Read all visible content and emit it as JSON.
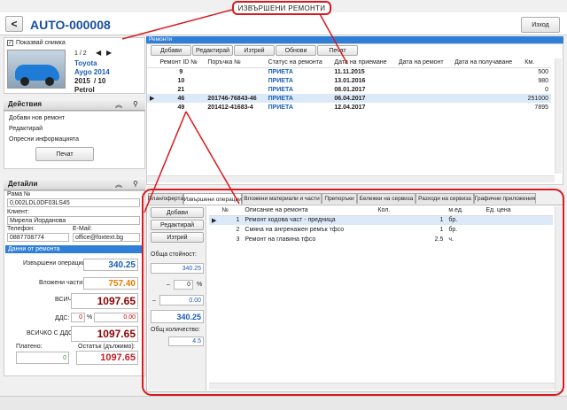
{
  "annotation": {
    "title": "ИЗВЪРШЕНИ РЕМОНТИ"
  },
  "header": {
    "back": "<",
    "title": "AUTO-000008",
    "exit": "Изход"
  },
  "vehicle": {
    "show_image": "Показвай снимка",
    "pager": "1 / 2",
    "make": "Toyota",
    "model": "Aygo 2014",
    "year": "2015",
    "month": "/ 10",
    "fuel": "Petrol"
  },
  "actions": {
    "title": "Действия",
    "items": [
      "Добави нов ремонт",
      "Редактирай",
      "Опресни информацията"
    ],
    "print": "Печат"
  },
  "details": {
    "title": "Детайли",
    "vin_label": "Рама №",
    "vin": "0,002LDL0DF03LS45",
    "client_label": "Клиент:",
    "client": "Мирела Йорданова",
    "phone_label": "Телефон:",
    "phone": "0887708774",
    "email_label": "E-Mail:",
    "email": "office@foxtext.bg",
    "repair_data": "Данни от ремонта",
    "ops_label": "Извършени операции:",
    "ops": "340.25",
    "parts_label": "Вложени части:",
    "parts": "757.40",
    "total_label": "ВСИЧКО:",
    "total": "1097.65",
    "vat_label": "ДДС:",
    "vat_pct": "0",
    "vat_sign": "%",
    "vat_val": "0.00",
    "total_vat_label": "ВСИЧКО С ДДС:",
    "total_vat": "1097.65",
    "paid_label": "Платено:",
    "paid": "0",
    "remaining_label": "Остатък (дължимо):",
    "remaining": "1097.65"
  },
  "repairs": {
    "tab": "Ремонти",
    "toolbar": [
      "Добави",
      "Редактирай",
      "Изтрий",
      "Обнови",
      "Печат"
    ],
    "columns": [
      "Ремонт ID №",
      "Поръчка №",
      "Статус на ремонта",
      "Дата на приемане",
      "Дата на ремонт",
      "Дата на получаване",
      "Км."
    ],
    "rows": [
      {
        "id": "9",
        "order": "",
        "status": "ПРИЕТА",
        "received": "11.11.2015",
        "repaired": "",
        "delivered": "",
        "km": "500",
        "selected": false
      },
      {
        "id": "10",
        "order": "",
        "status": "ПРИЕТА",
        "received": "13.01.2016",
        "repaired": "",
        "delivered": "",
        "km": "980",
        "selected": false
      },
      {
        "id": "21",
        "order": "",
        "status": "ПРИЕТА",
        "received": "08.01.2017",
        "repaired": "",
        "delivered": "",
        "km": "0",
        "selected": false
      },
      {
        "id": "46",
        "order": "201746-76843-46",
        "status": "ПРИЕТА",
        "received": "06.04.2017",
        "repaired": "",
        "delivered": "",
        "km": "251000",
        "selected": true
      },
      {
        "id": "49",
        "order": "201412-41683-4",
        "status": "ПРИЕТА",
        "received": "12.04.2017",
        "repaired": "",
        "delivered": "",
        "km": "7895",
        "selected": false
      }
    ]
  },
  "bottom_tabs": [
    "План/оферта",
    "Извършени операции",
    "Вложени материали и части",
    "Препоръки",
    "Бележки на сервиза",
    "Разходи на сервиза",
    "Графични приложения"
  ],
  "ops_panel": {
    "buttons": [
      "Добави",
      "Редактирай",
      "Изтрий"
    ],
    "total_cost_label": "Обща стойност:",
    "total_cost": "340.25",
    "discount_sign": "–",
    "discount_pct": "0",
    "pct_sign": "%",
    "discount_val": "0.00",
    "net": "340.25",
    "qty_label": "Общ количество:",
    "qty": "4.5",
    "columns": [
      "№",
      "Описание на ремонта",
      "Кол.",
      "м.ед.",
      "Ед. цена"
    ],
    "rows": [
      {
        "n": "1",
        "desc": "Ремонт ходова част - предница",
        "qty": "1",
        "unit": "бр."
      },
      {
        "n": "2",
        "desc": "Смяна на ангренажен ремък тфсо",
        "qty": "1",
        "unit": "бр."
      },
      {
        "n": "3",
        "desc": "Ремонт на главина тфсо",
        "qty": "2.5",
        "unit": "ч."
      }
    ]
  }
}
